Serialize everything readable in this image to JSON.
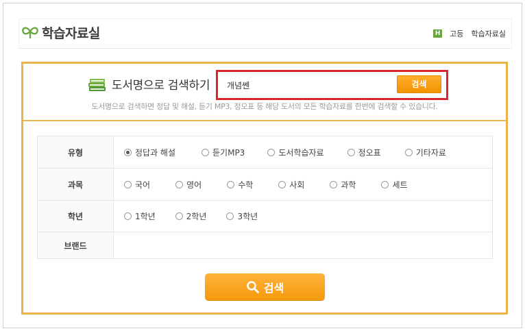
{
  "header": {
    "logo_text": "학습자료실",
    "crumb_badge": "H",
    "crumbs": [
      "고등",
      "학습자료실"
    ]
  },
  "search": {
    "title": "도서명으로 검색하기",
    "input_value": "개념쎈",
    "button_label": "검색",
    "description": "도서명으로 검색하면 정답 및 해설, 듣기 MP3, 정오표 등 해당 도서의 모든 학습자료를 한번에 검색할 수 있습니다."
  },
  "filters": [
    {
      "label": "유형",
      "options": [
        "정답과 해설",
        "듣기MP3",
        "도서학습자료",
        "정오표",
        "기타자료"
      ],
      "selected": 0
    },
    {
      "label": "과목",
      "options": [
        "국어",
        "영어",
        "수학",
        "사회",
        "과학",
        "세트"
      ],
      "selected": -1
    },
    {
      "label": "학년",
      "options": [
        "1학년",
        "2학년",
        "3학년"
      ],
      "selected": -1
    },
    {
      "label": "브랜드",
      "options": [],
      "selected": -1
    }
  ],
  "big_search_label": "검색",
  "colors": {
    "accent_orange": "#f29200",
    "panel_border": "#eab44c",
    "highlight_red": "#d9262b",
    "logo_green": "#6aa83a"
  }
}
